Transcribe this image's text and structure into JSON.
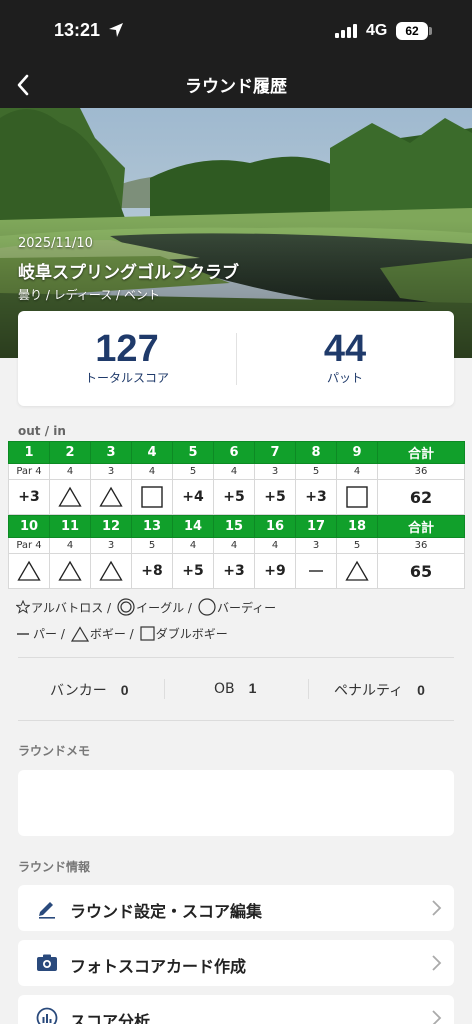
{
  "status": {
    "time": "13:21",
    "network": "4G",
    "battery": "62"
  },
  "nav": {
    "title": "ラウンド履歴"
  },
  "round": {
    "date": "2025/11/10",
    "club": "岐阜スプリングゴルフクラブ",
    "conditions": "曇り / レディース / ベント"
  },
  "summary": {
    "total_score": "127",
    "total_label": "トータルスコア",
    "putts": "44",
    "putts_label": "パット"
  },
  "outin_label": "out / in",
  "scorecard": {
    "total_label": "合計",
    "out": {
      "holes": [
        "1",
        "2",
        "3",
        "4",
        "5",
        "6",
        "7",
        "8",
        "9"
      ],
      "par": [
        "Par 4",
        "4",
        "3",
        "4",
        "5",
        "4",
        "3",
        "5",
        "4"
      ],
      "par_total": "36",
      "scores": [
        "+3",
        "triangle",
        "triangle",
        "square",
        "+4",
        "+5",
        "+5",
        "+3",
        "square"
      ],
      "total": "62"
    },
    "in": {
      "holes": [
        "10",
        "11",
        "12",
        "13",
        "14",
        "15",
        "16",
        "17",
        "18"
      ],
      "par": [
        "Par 4",
        "4",
        "3",
        "5",
        "4",
        "4",
        "4",
        "3",
        "5"
      ],
      "par_total": "36",
      "scores": [
        "triangle",
        "triangle",
        "triangle",
        "+8",
        "+5",
        "+3",
        "+9",
        "dash",
        "triangle"
      ],
      "total": "65"
    }
  },
  "legend": {
    "albatross": "アルバトロス /",
    "eagle": "イーグル /",
    "birdie": "バーディー",
    "par": "パー /",
    "bogey": "ボギー /",
    "double_bogey": "ダブルボギー"
  },
  "stats": {
    "bunker_label": "バンカー",
    "bunker": "0",
    "ob_label": "OB",
    "ob": "1",
    "penalty_label": "ペナルティ",
    "penalty": "0"
  },
  "memo_section": "ラウンドメモ",
  "info_section": "ラウンド情報",
  "menu": {
    "edit": "ラウンド設定・スコア編集",
    "photo": "フォトスコアカード作成",
    "analysis": "スコア分析"
  },
  "colors": {
    "accent_green": "#11a02b",
    "navy": "#1f3a6a",
    "header": "#1e1e1e"
  }
}
